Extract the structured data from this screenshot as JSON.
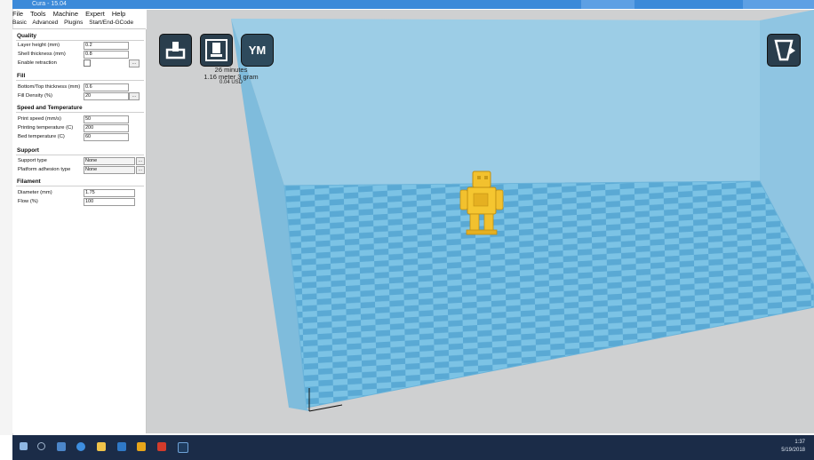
{
  "window": {
    "title": "Cura - 15.04"
  },
  "menu": [
    "File",
    "Tools",
    "Machine",
    "Expert",
    "Help"
  ],
  "tabs": [
    "Basic",
    "Advanced",
    "Plugins",
    "Start/End-GCode"
  ],
  "panel": {
    "quality": {
      "title": "Quality",
      "layer_height": {
        "label": "Layer height (mm)",
        "value": "0.2"
      },
      "shell_thickness": {
        "label": "Shell thickness (mm)",
        "value": "0.8"
      },
      "retraction": {
        "label": "Enable retraction",
        "value": ""
      }
    },
    "fill": {
      "title": "Fill",
      "bottom_top": {
        "label": "Bottom/Top thickness (mm)",
        "value": "0.6"
      },
      "density": {
        "label": "Fill Density (%)",
        "value": "20"
      }
    },
    "speed": {
      "title": "Speed and Temperature",
      "print_speed": {
        "label": "Print speed (mm/s)",
        "value": "50"
      },
      "print_temp": {
        "label": "Printing temperature (C)",
        "value": "200"
      },
      "bed_temp": {
        "label": "Bed temperature (C)",
        "value": "60"
      }
    },
    "support": {
      "title": "Support",
      "support_type": {
        "label": "Support type",
        "value": "None"
      },
      "adhesion": {
        "label": "Platform adhesion type",
        "value": "None"
      }
    },
    "filament": {
      "title": "Filament",
      "diameter": {
        "label": "Diameter (mm)",
        "value": "1.75"
      },
      "flow": {
        "label": "Flow (%)",
        "value": "100"
      }
    },
    "more_btn": "..."
  },
  "toolbar": {
    "ym_label": "YM"
  },
  "model_info": {
    "time": "26 minutes",
    "material": "1.16 meter 3 gram",
    "cost": "0.04 USD"
  },
  "colors": {
    "build_volume": "#a8d2e6",
    "bed_light": "#7cc3e5",
    "bed_dark": "#5aa9d4",
    "model": "#f2c12e",
    "taskbar": "#1b2c48"
  },
  "tray": {
    "time": "1:37",
    "date": "5/19/2018"
  }
}
